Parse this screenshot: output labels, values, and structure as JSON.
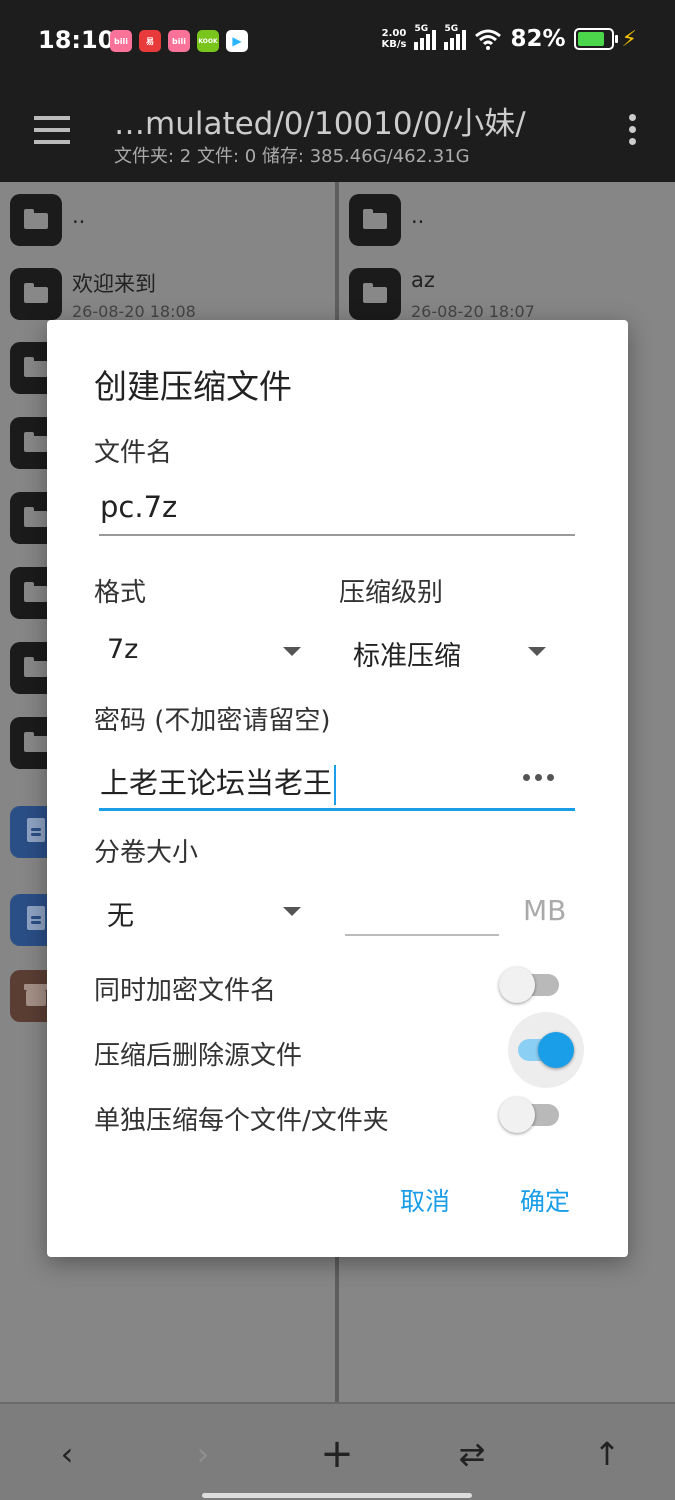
{
  "status_bar": {
    "time": "18:10",
    "apps": [
      {
        "name": "bilibili-icon",
        "label": "bili",
        "color": "#fb7299"
      },
      {
        "name": "app2-icon",
        "label": "易",
        "color": "#e83a3a"
      },
      {
        "name": "bilibili2-icon",
        "label": "bili",
        "color": "#fb7299"
      },
      {
        "name": "kook-icon",
        "label": "KOOK",
        "color": "#7ac51c"
      },
      {
        "name": "play-icon",
        "label": "▶",
        "color": "#2ab6ff"
      }
    ],
    "net_speed_value": "2.00",
    "net_speed_unit": "KB/s",
    "signal1_label": "5G",
    "signal2_label": "5G",
    "battery_percent": "82%",
    "battery_level": 0.82,
    "battery_color": "#4cd64c"
  },
  "toolbar": {
    "path": "…mulated/0/10010/0/小妹/",
    "info": "文件夹: 2  文件: 0  储存: 385.46G/462.31G"
  },
  "left_pane": {
    "items": [
      {
        "name": "..",
        "date": ""
      },
      {
        "name": "欢迎来到",
        "date": "26-08-20 18:08"
      }
    ]
  },
  "right_pane": {
    "items": [
      {
        "name": "..",
        "date": ""
      },
      {
        "name": "az",
        "date": "26-08-20 18:07"
      }
    ]
  },
  "dialog": {
    "title": "创建压缩文件",
    "filename_label": "文件名",
    "filename_value": "pc.7z",
    "format_label": "格式",
    "format_value": "7z",
    "level_label": "压缩级别",
    "level_value": "标准压缩",
    "password_label": "密码 (不加密请留空)",
    "password_value": "上老王论坛当老王",
    "volume_label": "分卷大小",
    "volume_value": "无",
    "volume_size_value": "",
    "volume_unit": "MB",
    "encrypt_names_label": "同时加密文件名",
    "encrypt_names_on": false,
    "delete_source_label": "压缩后删除源文件",
    "delete_source_on": true,
    "separate_label": "单独压缩每个文件/文件夹",
    "separate_on": false,
    "cancel_label": "取消",
    "ok_label": "确定",
    "accent_color": "#1a9ee8"
  },
  "bottom_bar": {
    "back": "‹",
    "forward": "›",
    "add": "+",
    "swap": "⇄",
    "up": "↑"
  }
}
